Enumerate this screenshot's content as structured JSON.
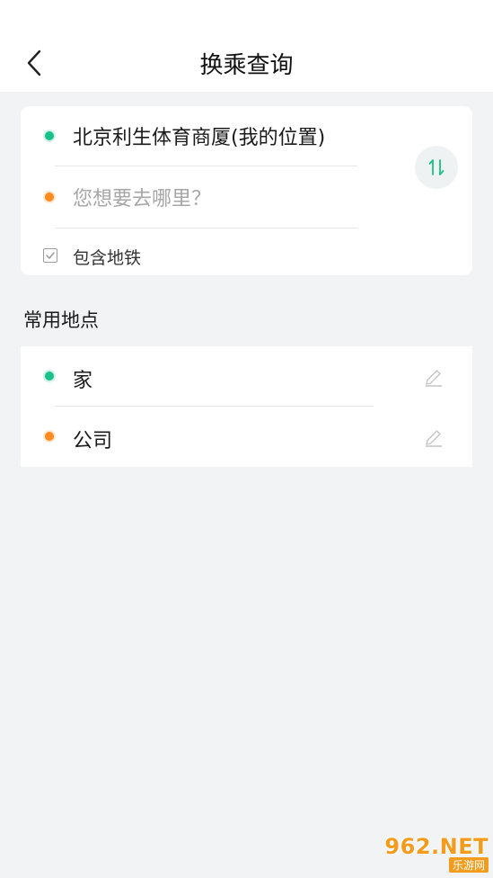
{
  "header": {
    "title": "换乘查询"
  },
  "route": {
    "origin": "北京利生体育商厦(我的位置)",
    "destination_placeholder": "您想要去哪里？",
    "include_subway_label": "包含地铁",
    "include_subway_checked": true
  },
  "favorites": {
    "section_title": "常用地点",
    "items": [
      {
        "label": "家",
        "dot_color": "#19c08a"
      },
      {
        "label": "公司",
        "dot_color": "#ff8a1e"
      }
    ]
  },
  "watermark": {
    "main": "962.NET",
    "sub": "乐游网"
  },
  "colors": {
    "accent": "#19c08a",
    "orange": "#ff8a1e",
    "background": "#f2f3f5"
  },
  "icons": [
    "back-arrow-icon",
    "swap-icon",
    "checkbox-icon",
    "edit-pencil-icon"
  ]
}
